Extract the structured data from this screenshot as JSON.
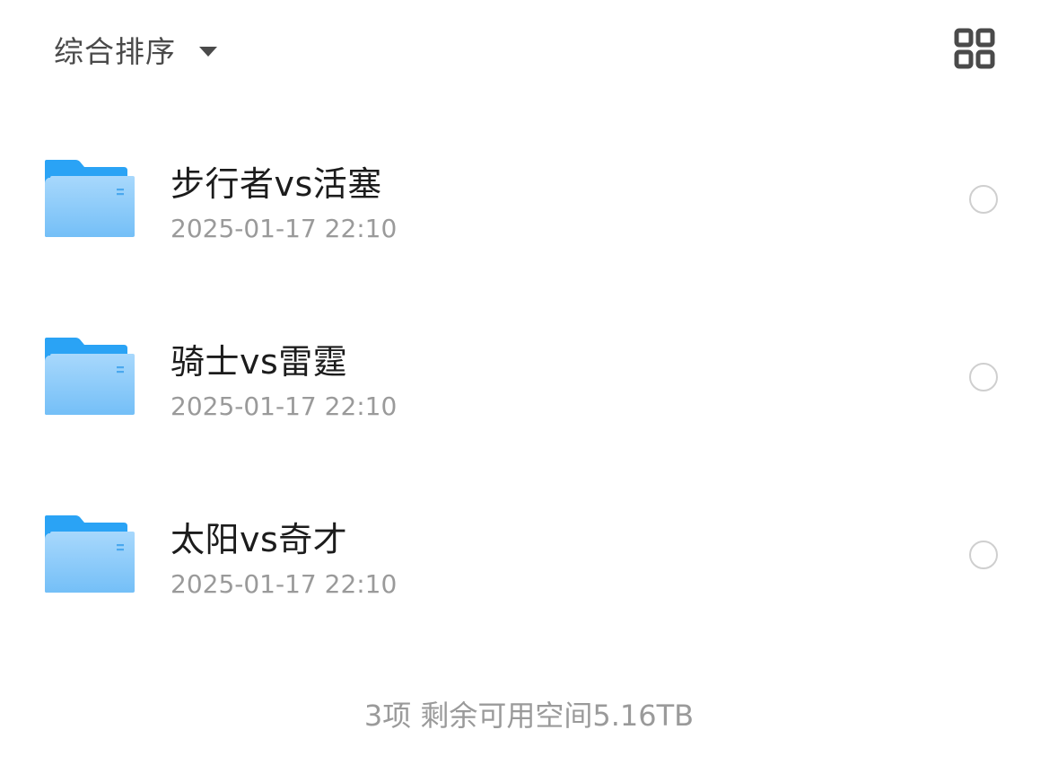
{
  "toolbar": {
    "sort_label": "综合排序",
    "sort_icon": "caret-down-icon",
    "view_toggle_icon": "grid-view-icon"
  },
  "files": [
    {
      "name": "步行者vs活塞",
      "date": "2025-01-17 22:10",
      "icon": "folder-icon"
    },
    {
      "name": "骑士vs雷霆",
      "date": "2025-01-17 22:10",
      "icon": "folder-icon"
    },
    {
      "name": "太阳vs奇才",
      "date": "2025-01-17 22:10",
      "icon": "folder-icon"
    }
  ],
  "footer": {
    "summary": "3项 剩余可用空间5.16TB"
  },
  "colors": {
    "folder_back": "#2aa3f5",
    "folder_front_top": "#9fd3fb",
    "folder_front_bottom": "#6fbcf6",
    "text_primary": "#1c1c1c",
    "text_secondary": "#9a9a9a",
    "radio_border": "#cfcfcf"
  }
}
